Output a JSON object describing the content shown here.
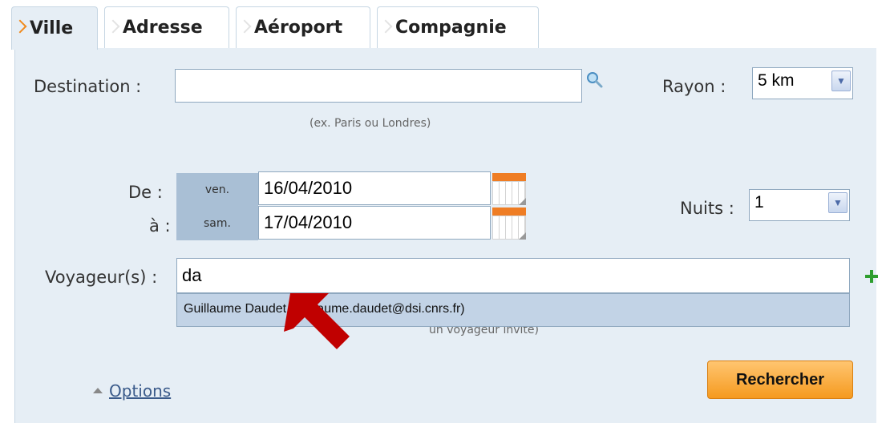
{
  "tabs": [
    {
      "label": "Ville",
      "active": true
    },
    {
      "label": "Adresse"
    },
    {
      "label": "Aéroport"
    },
    {
      "label": "Compagnie"
    }
  ],
  "destination": {
    "label": "Destination :",
    "value": "",
    "hint": "(ex. Paris ou Londres)"
  },
  "rayon": {
    "label": "Rayon :",
    "value": "5 km"
  },
  "dates": {
    "from_label": "De :",
    "to_label": "à :",
    "from_day": "ven.",
    "from_date": "16/04/2010",
    "to_day": "sam.",
    "to_date": "17/04/2010"
  },
  "nuits": {
    "label": "Nuits :",
    "value": "1"
  },
  "voyageur": {
    "label": "Voyageur(s) :",
    "value": "da",
    "suggestion": "Guillaume Daudet (guillaume.daudet@dsi.cnrs.fr)",
    "hint_partial": "un voyageur invité)"
  },
  "options_link": "Options",
  "search_button": "Rechercher",
  "colors": {
    "accent": "#f08a1c",
    "panel": "#e6eef5",
    "arrow": "#c00000",
    "plus": "#2e9e2e"
  }
}
